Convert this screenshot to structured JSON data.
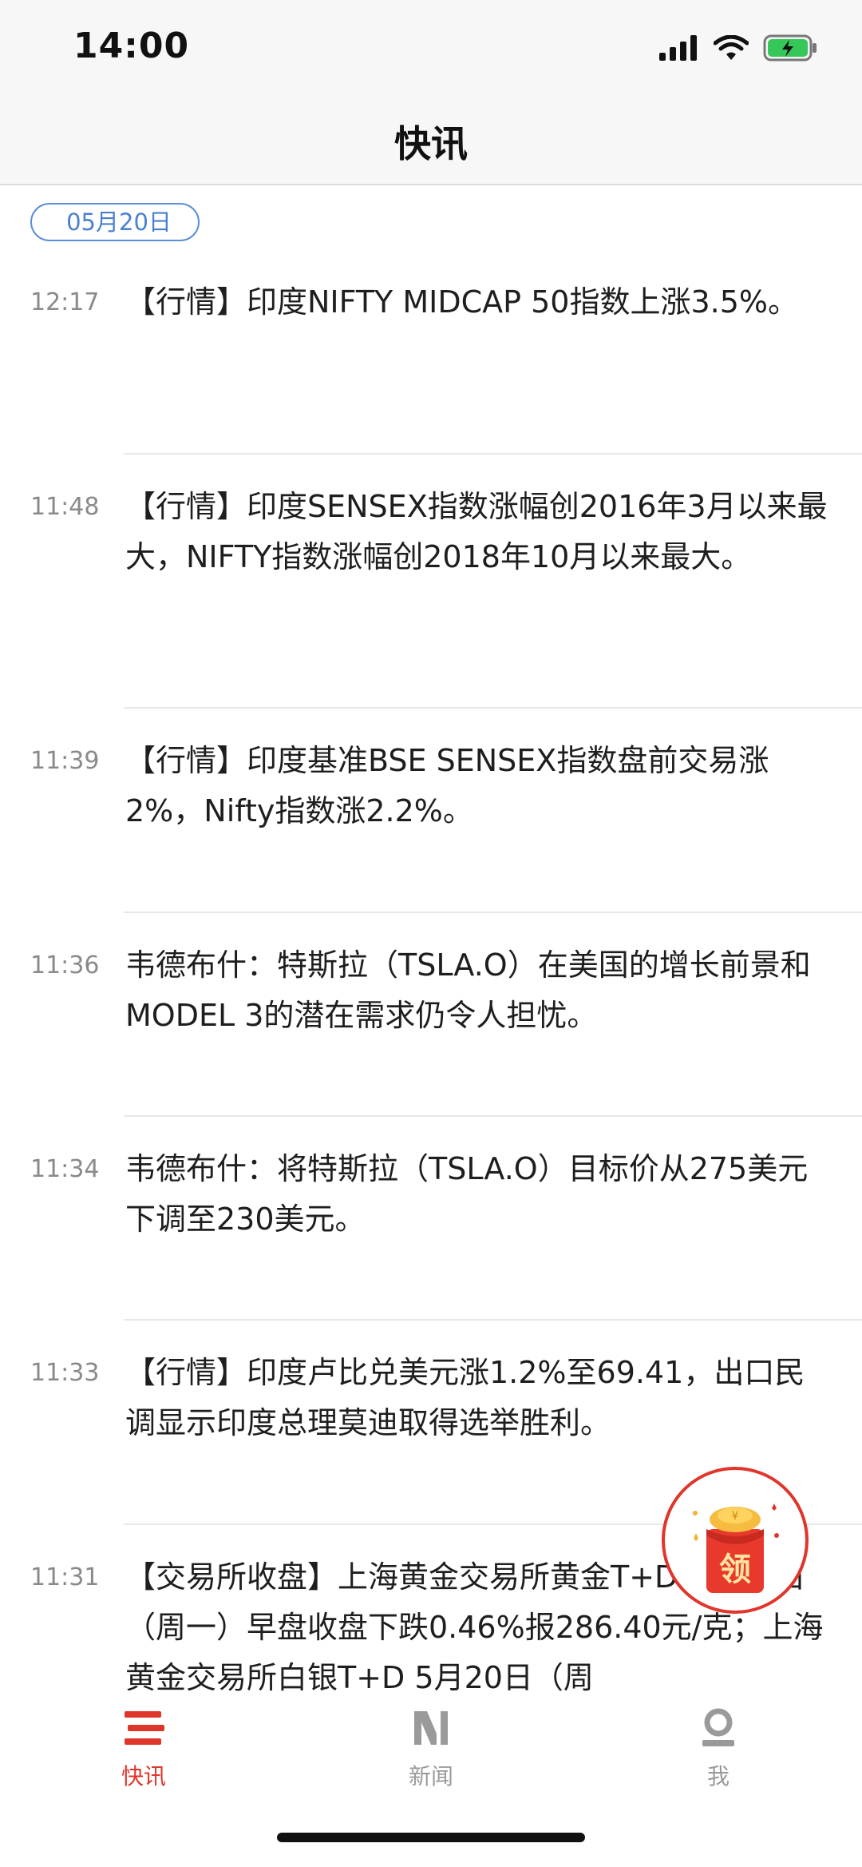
{
  "status": {
    "time": "14:00"
  },
  "header": {
    "title": "快讯"
  },
  "feed": {
    "date": "05月20日",
    "items": [
      {
        "time": "12:17",
        "text": "【行情】印度NIFTY MIDCAP 50指数上涨3.5%。"
      },
      {
        "time": "11:48",
        "text": "【行情】印度SENSEX指数涨幅创2016年3月以来最大，NIFTY指数涨幅创2018年10月以来最大。"
      },
      {
        "time": "11:39",
        "text": "【行情】印度基准BSE SENSEX指数盘前交易涨2%，Nifty指数涨2.2%。"
      },
      {
        "time": "11:36",
        "text": "韦德布什：特斯拉（TSLA.O）在美国的增长前景和MODEL 3的潜在需求仍令人担忧。"
      },
      {
        "time": "11:34",
        "text": "韦德布什：将特斯拉（TSLA.O）目标价从275美元下调至230美元。"
      },
      {
        "time": "11:33",
        "text": "【行情】印度卢比兑美元涨1.2%至69.41，出口民调显示印度总理莫迪取得选举胜利。"
      },
      {
        "time": "11:31",
        "text": "【交易所收盘】上海黄金交易所黄金T+D 5月20日（周一）早盘收盘下跌0.46%报286.40元/克；上海黄金交易所白银T+D 5月20日（周"
      }
    ]
  },
  "fab": {
    "label": "领",
    "icon": "red-envelope-icon"
  },
  "tabs": [
    {
      "label": "快讯",
      "icon": "list-icon",
      "active": true
    },
    {
      "label": "新闻",
      "icon": "news-n-icon",
      "active": false
    },
    {
      "label": "我",
      "icon": "profile-icon",
      "active": false
    }
  ],
  "colors": {
    "accent": "#e0352b",
    "date_blue": "#4a80d0",
    "inactive": "#9a9a9a"
  }
}
